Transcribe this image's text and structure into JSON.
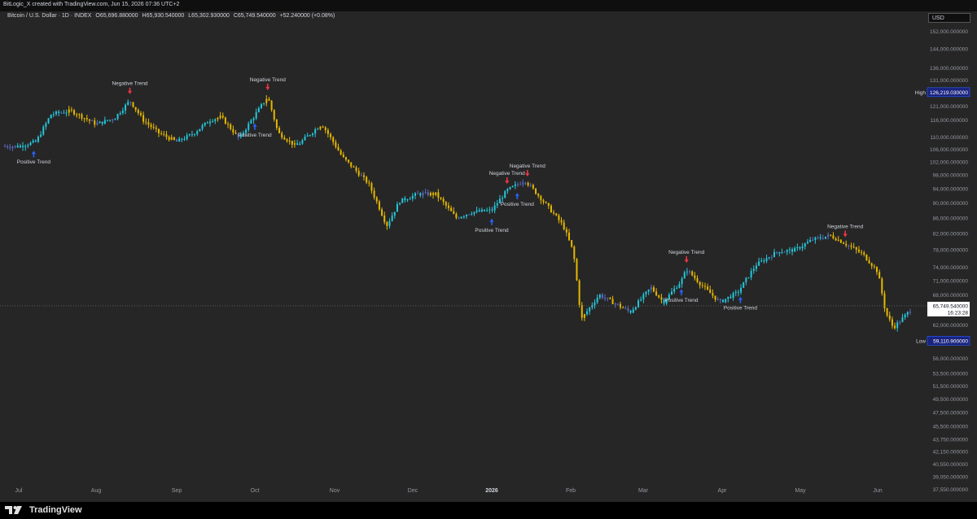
{
  "header": {
    "credit": "BitLogic_X created with TradingView.com, Jun 15, 2026 07:36 UTC+2",
    "symbol": "Bitcoin / U.S. Dollar · 1D · INDEX",
    "open": "O65,696.880000",
    "high": "H65,930.540000",
    "low": "L65,302.930000",
    "close": "C65,749.540000",
    "change": "+52.240000 (+0.08%)",
    "currency": "USD"
  },
  "footer": {
    "brand": "TradingView"
  },
  "colors": {
    "background": "#262626",
    "bull_cyan": "#26c6da",
    "bear_gold": "#e6b800",
    "neutral_blue": "#5c6bc0",
    "arrow_up": "#2962ff",
    "arrow_down": "#f23645",
    "label_blue": "#2962ff"
  },
  "chart_data": {
    "type": "bar",
    "title": "Bitcoin / U.S. Dollar · 1D · INDEX",
    "x_ticks": [
      "Jul",
      "Aug",
      "Sep",
      "Oct",
      "Nov",
      "Dec",
      "2026",
      "Feb",
      "Mar",
      "Apr",
      "May",
      "Jun"
    ],
    "y_ticks": [
      "152,000.000000",
      "144,000.000000",
      "136,000.000000",
      "131,000.000000",
      "121,000.000000",
      "116,000.000000",
      "110,000.000000",
      "106,000.000000",
      "102,000.000000",
      "98,000.000000",
      "94,000.000000",
      "90,000.000000",
      "86,000.000000",
      "82,000.000000",
      "78,000.000000",
      "74,000.000000",
      "71,000.000000",
      "68,000.000000",
      "62,000.000000",
      "56,000.000000",
      "53,500.000000",
      "51,500.000000",
      "49,500.000000",
      "47,500.000000",
      "45,500.000000",
      "43,750.000000",
      "42,150.000000",
      "40,550.000000",
      "39,050.000000",
      "37,550.000000"
    ],
    "price_labels": {
      "high": {
        "label": "High",
        "value": "126,219.030000"
      },
      "low": {
        "label": "Low",
        "value": "59,110.900000"
      },
      "last": {
        "value": "65,749.540000",
        "countdown": "16:23:28"
      }
    },
    "trend_signals": [
      {
        "label": "Positive Trend",
        "date": "Jul 07"
      },
      {
        "label": "Negative Trend",
        "date": "Aug 14"
      },
      {
        "label": "Negative Trend",
        "date": "Oct 06"
      },
      {
        "label": "Positive Trend",
        "date": "Oct 01"
      },
      {
        "label": "Negative Trend",
        "date": "Jan 07"
      },
      {
        "label": "Negative Trend",
        "date": "Jan 15"
      },
      {
        "label": "Positive Trend",
        "date": "Jan 01"
      },
      {
        "label": "Positive Trend",
        "date": "Jan 11"
      },
      {
        "label": "Negative Trend",
        "date": "Mar 18"
      },
      {
        "label": "Positive Trend",
        "date": "Mar 16"
      },
      {
        "label": "Positive Trend",
        "date": "Apr 08"
      },
      {
        "label": "Negative Trend",
        "date": "May 19"
      }
    ],
    "price_path": [
      {
        "date": "Jul 01",
        "close": 107000
      },
      {
        "date": "Jul 08",
        "close": 108500
      },
      {
        "date": "Jul 14",
        "close": 118000
      },
      {
        "date": "Jul 22",
        "close": 119200
      },
      {
        "date": "Aug 01",
        "close": 114500
      },
      {
        "date": "Aug 08",
        "close": 116500
      },
      {
        "date": "Aug 14",
        "close": 123000
      },
      {
        "date": "Aug 19",
        "close": 116000
      },
      {
        "date": "Aug 25",
        "close": 111500
      },
      {
        "date": "Sep 01",
        "close": 108500
      },
      {
        "date": "Sep 07",
        "close": 111000
      },
      {
        "date": "Sep 14",
        "close": 116000
      },
      {
        "date": "Sep 18",
        "close": 117000
      },
      {
        "date": "Sep 25",
        "close": 109500
      },
      {
        "date": "Oct 02",
        "close": 119000
      },
      {
        "date": "Oct 06",
        "close": 124500
      },
      {
        "date": "Oct 10",
        "close": 111500
      },
      {
        "date": "Oct 17",
        "close": 107000
      },
      {
        "date": "Oct 27",
        "close": 114500
      },
      {
        "date": "Nov 04",
        "close": 103500
      },
      {
        "date": "Nov 14",
        "close": 95500
      },
      {
        "date": "Nov 21",
        "close": 84000
      },
      {
        "date": "Nov 26",
        "close": 90500
      },
      {
        "date": "Dec 03",
        "close": 92500
      },
      {
        "date": "Dec 10",
        "close": 92500
      },
      {
        "date": "Dec 18",
        "close": 86000
      },
      {
        "date": "Dec 24",
        "close": 87500
      },
      {
        "date": "Jan 01",
        "close": 88000
      },
      {
        "date": "Jan 07",
        "close": 93500
      },
      {
        "date": "Jan 14",
        "close": 96500
      },
      {
        "date": "Jan 20",
        "close": 91500
      },
      {
        "date": "Jan 29",
        "close": 84000
      },
      {
        "date": "Feb 02",
        "close": 77500
      },
      {
        "date": "Feb 05",
        "close": 63000
      },
      {
        "date": "Feb 12",
        "close": 68000
      },
      {
        "date": "Feb 24",
        "close": 64500
      },
      {
        "date": "Mar 04",
        "close": 69500
      },
      {
        "date": "Mar 09",
        "close": 66500
      },
      {
        "date": "Mar 16",
        "close": 71000
      },
      {
        "date": "Mar 18",
        "close": 73500
      },
      {
        "date": "Mar 24",
        "close": 70000
      },
      {
        "date": "Mar 31",
        "close": 66500
      },
      {
        "date": "Apr 07",
        "close": 68500
      },
      {
        "date": "Apr 14",
        "close": 74500
      },
      {
        "date": "Apr 22",
        "close": 77500
      },
      {
        "date": "Apr 29",
        "close": 78000
      },
      {
        "date": "May 06",
        "close": 80500
      },
      {
        "date": "May 13",
        "close": 81500
      },
      {
        "date": "May 19",
        "close": 79500
      },
      {
        "date": "May 26",
        "close": 77000
      },
      {
        "date": "Jun 01",
        "close": 73000
      },
      {
        "date": "Jun 04",
        "close": 64500
      },
      {
        "date": "Jun 07",
        "close": 61500
      },
      {
        "date": "Jun 11",
        "close": 63500
      },
      {
        "date": "Jun 15",
        "close": 65749.54
      }
    ]
  }
}
